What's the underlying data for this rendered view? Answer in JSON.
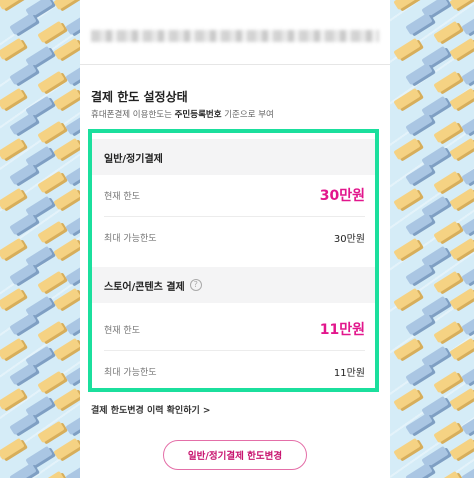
{
  "limit_status": {
    "title": "결제 한도 설정상태",
    "subtitle_pre": "휴대폰결제 이용한도는 ",
    "subtitle_bold": "주민등록번호",
    "subtitle_post": " 기준으로 부여"
  },
  "general": {
    "heading": "일반/정기결제",
    "current_label": "현재 한도",
    "current_value": "30만원",
    "max_label": "최대 가능한도",
    "max_value": "30만원"
  },
  "store": {
    "heading": "스토어/콘텐츠 결제",
    "help_glyph": "?",
    "current_label": "현재 한도",
    "current_value": "11만원",
    "max_label": "최대 가능한도",
    "max_value": "11만원"
  },
  "history_link": "결제 한도변경 이력 확인하기 >",
  "change_button": "일반/정기결제 한도변경",
  "colors": {
    "highlight_border": "#1bdf9d",
    "accent_pink": "#e2168c",
    "background": "#d5ecf7"
  }
}
